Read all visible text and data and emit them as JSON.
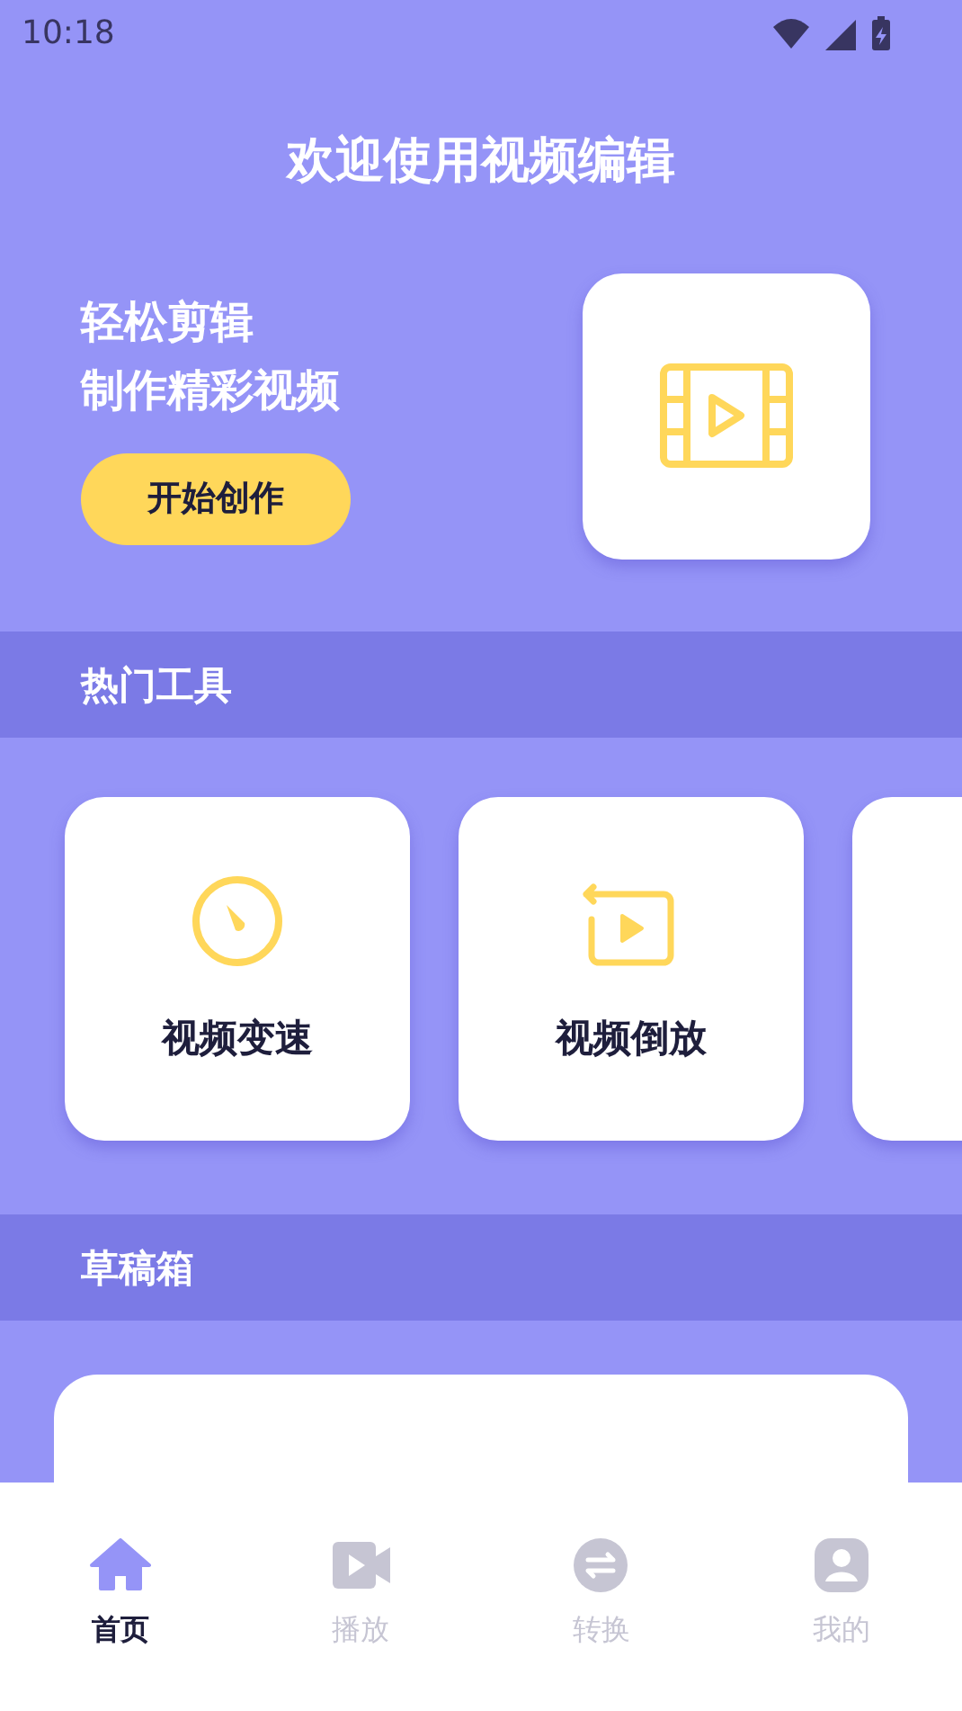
{
  "status_bar": {
    "time": "10:18"
  },
  "title": "欢迎使用视频编辑",
  "hero": {
    "lines": [
      "轻松剪辑",
      "制作精彩视频"
    ],
    "button": "开始创作"
  },
  "hot_tools": {
    "heading": "热门工具",
    "tools": [
      {
        "label": "视频变速"
      },
      {
        "label": "视频倒放"
      }
    ]
  },
  "drafts": {
    "heading": "草稿箱"
  },
  "nav": [
    {
      "label": "首页",
      "selected": true
    },
    {
      "label": "播放",
      "selected": false
    },
    {
      "label": "转换",
      "selected": false
    },
    {
      "label": "我的",
      "selected": false
    }
  ]
}
